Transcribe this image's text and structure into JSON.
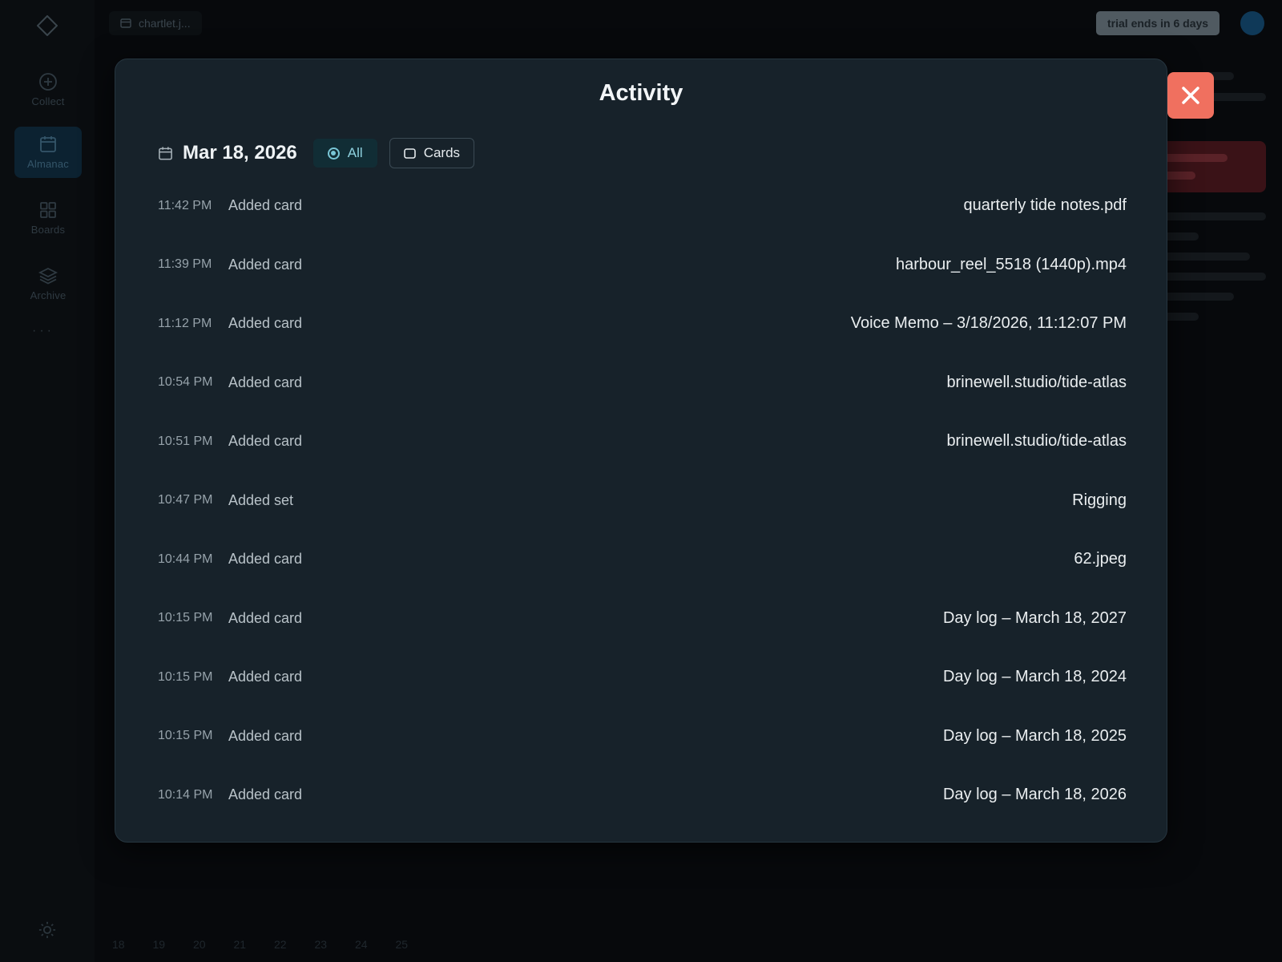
{
  "sidebar": {
    "items": [
      {
        "label": "Collect",
        "icon": "plus-circle-icon"
      },
      {
        "label": "Almanac",
        "icon": "calendar-icon",
        "active": true
      },
      {
        "label": "Boards",
        "icon": "grid-icon"
      },
      {
        "label": "Archive",
        "icon": "layers-icon"
      }
    ],
    "more_label": "···"
  },
  "topbar": {
    "file_chip": "chartlet.j...",
    "trial_badge": "trial ends in 6 days"
  },
  "calendar_strip": [
    "18",
    "19",
    "20",
    "21",
    "22",
    "23",
    "24",
    "25"
  ],
  "modal": {
    "title": "Activity",
    "date": "Mar 18, 2026",
    "filters": {
      "all_label": "All",
      "cards_label": "Cards",
      "selected": "All"
    },
    "entries": [
      {
        "time": "11:42 PM",
        "action": "Added card",
        "target": "quarterly tide notes.pdf"
      },
      {
        "time": "11:39 PM",
        "action": "Added card",
        "target": "harbour_reel_5518 (1440p).mp4"
      },
      {
        "time": "11:12 PM",
        "action": "Added card",
        "target": "Voice Memo – 3/18/2026, 11:12:07 PM"
      },
      {
        "time": "10:54 PM",
        "action": "Added card",
        "target": "brinewell.studio/tide-atlas"
      },
      {
        "time": "10:51 PM",
        "action": "Added card",
        "target": "brinewell.studio/tide-atlas"
      },
      {
        "time": "10:47 PM",
        "action": "Added set",
        "target": "Rigging"
      },
      {
        "time": "10:44 PM",
        "action": "Added card",
        "target": "62.jpeg"
      },
      {
        "time": "10:15 PM",
        "action": "Added card",
        "target": "Day log – March 18, 2027"
      },
      {
        "time": "10:15 PM",
        "action": "Added card",
        "target": "Day log – March 18, 2024"
      },
      {
        "time": "10:15 PM",
        "action": "Added card",
        "target": "Day log – March 18, 2025"
      },
      {
        "time": "10:14 PM",
        "action": "Added card",
        "target": "Day log – March 18, 2026"
      }
    ]
  },
  "colors": {
    "close_button": "#f0705f",
    "accent": "#79c6d6",
    "modal_bg": "#17222a"
  }
}
